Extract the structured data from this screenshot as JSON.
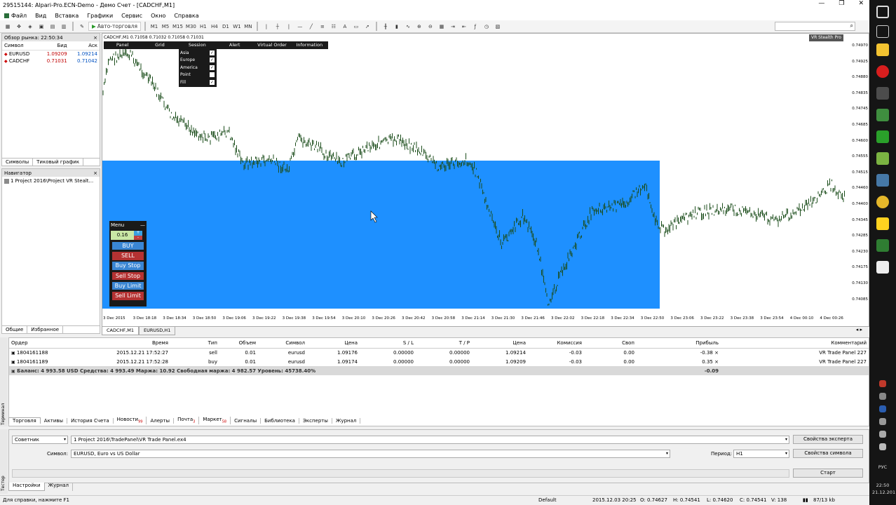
{
  "window": {
    "title": "29515144: Alpari-Pro.ECN-Demo - Демо Счет - [CADCHF,M1]",
    "buttons": [
      "—",
      "❐",
      "✕"
    ]
  },
  "menu": [
    "Файл",
    "Вид",
    "Вставка",
    "Графики",
    "Сервис",
    "Окно",
    "Справка"
  ],
  "toolbar": {
    "auto_trading": "Авто-торговля",
    "timeframes": [
      "M1",
      "M5",
      "M15",
      "M30",
      "H1",
      "H4",
      "D1",
      "W1",
      "MN"
    ]
  },
  "market_watch": {
    "title": "Обзор рынка: 22:50:34",
    "columns": [
      "Символ",
      "Бид",
      "Аск"
    ],
    "rows": [
      {
        "symbol": "EURUSD",
        "bid": "1.09209",
        "ask": "1.09214"
      },
      {
        "symbol": "CADCHF",
        "bid": "0.71031",
        "ask": "0.71042"
      }
    ],
    "tabs": [
      "Символы",
      "Тиковый график"
    ]
  },
  "navigator": {
    "title": "Навигатор",
    "item": "1 Project 2016\\Project VR Stealt...",
    "tabs": [
      "Общие",
      "Избранное"
    ]
  },
  "chart": {
    "header": "CADCHF,M1  0.71058 0.71032 0.71058 0.71031",
    "badge": "VR Stealth Pro",
    "top_menu": [
      "Panel",
      "Grid",
      "Session",
      "Alert",
      "Virtual Order",
      "Information"
    ],
    "sessions": [
      {
        "name": "Asia",
        "checked": "✓"
      },
      {
        "name": "Europe",
        "checked": "✓"
      },
      {
        "name": "America",
        "checked": "✓"
      },
      {
        "name": "Point",
        "checked": ""
      },
      {
        "name": "Fill",
        "checked": "✓"
      }
    ],
    "trade_panel": {
      "title": "Menu",
      "lot": "0.16",
      "buttons": [
        "BUY",
        "SELL",
        "Buy Stop",
        "Sell Stop",
        "Buy Limit",
        "Sell Limit"
      ]
    },
    "session_fill_color": "#1e90ff",
    "price_labels": [
      "0.74970",
      "0.74925",
      "0.74880",
      "0.74835",
      "0.74745",
      "0.74685",
      "0.74600",
      "0.74555",
      "0.74515",
      "0.74460",
      "0.74400",
      "0.74345",
      "0.74285",
      "0.74230",
      "0.74175",
      "0.74130",
      "0.74085"
    ],
    "date_labels": [
      "3 Dec 2015",
      "3 Dec 18:18",
      "3 Dec 18:34",
      "3 Dec 18:50",
      "3 Dec 19:06",
      "3 Dec 19:22",
      "3 Dec 19:38",
      "3 Dec 19:54",
      "3 Dec 20:10",
      "3 Dec 20:26",
      "3 Dec 20:42",
      "3 Dec 20:58",
      "3 Dec 21:14",
      "3 Dec 21:30",
      "3 Dec 21:46",
      "3 Dec 22:02",
      "3 Dec 22:18",
      "3 Dec 22:34",
      "3 Dec 22:50",
      "3 Dec 23:06",
      "3 Dec 23:22",
      "3 Dec 23:38",
      "3 Dec 23:54",
      "4 Dec 00:10",
      "4 Dec 00:26"
    ],
    "tabs": [
      "CADCHF,M1",
      "EURUSD,H1"
    ]
  },
  "terminal": {
    "side_label": "Терминал",
    "columns": [
      "Ордер",
      "Время",
      "Тип",
      "Объем",
      "Символ",
      "Цена",
      "S / L",
      "T / P",
      "Цена",
      "Комиссия",
      "Своп",
      "Прибыль",
      "Комментарий"
    ],
    "orders": [
      {
        "order": "1804161188",
        "time": "2015.12.21 17:52:27",
        "type": "sell",
        "volume": "0.01",
        "symbol": "eurusd",
        "price": "1.09176",
        "sl": "0.00000",
        "tp": "0.00000",
        "cur_price": "1.09214",
        "commission": "-0.03",
        "swap": "0.00",
        "profit": "-0.38",
        "comment": "VR Trade Panel 227"
      },
      {
        "order": "1804161189",
        "time": "2015.12.21 17:52:28",
        "type": "buy",
        "volume": "0.01",
        "symbol": "eurusd",
        "price": "1.09174",
        "sl": "0.00000",
        "tp": "0.00000",
        "cur_price": "1.09209",
        "commission": "-0.03",
        "swap": "0.00",
        "profit": "0.35",
        "comment": "VR Trade Panel 227"
      }
    ],
    "balance": "Баланс: 4 993.58 USD  Средства: 4 993.49  Маржа: 10.92  Свободная маржа: 4 982.57  Уровень: 45738.40%",
    "balance_profit": "-0.09",
    "tabs": [
      "Торговля",
      "Активы",
      "История Счета",
      "Новости",
      "Алерты",
      "Почта",
      "Маркет",
      "Сигналы",
      "Библиотека",
      "Эксперты",
      "Журнал"
    ],
    "tab_badges": {
      "news": "99",
      "mail": "3",
      "market": "58"
    }
  },
  "tester": {
    "side_label": "Тестер",
    "type_value": "Советник",
    "expert_value": "1 Project 2016\\TradePanel\\VR Trade Panel.ex4",
    "symbol_label": "Символ:",
    "symbol_value": "EURUSD, Euro vs US Dollar",
    "period_label": "Период:",
    "period_value": "H1",
    "expert_props": "Свойства эксперта",
    "symbol_props": "Свойства символа",
    "start": "Старт",
    "tabs": [
      "Настройки",
      "Журнал"
    ]
  },
  "statusbar": {
    "help": "Для справки, нажмите F1",
    "profile": "Default",
    "datetime": "2015.12.03 20:25",
    "open": "O: 0.74627",
    "high": "H: 0.74541",
    "low": "L: 0.74620",
    "close": "C: 0.74541",
    "volume": "V: 138",
    "traffic": "87/13 kb"
  },
  "taskbar": {
    "lang": "РУС",
    "time": "22:50",
    "date": "21.12.201"
  }
}
